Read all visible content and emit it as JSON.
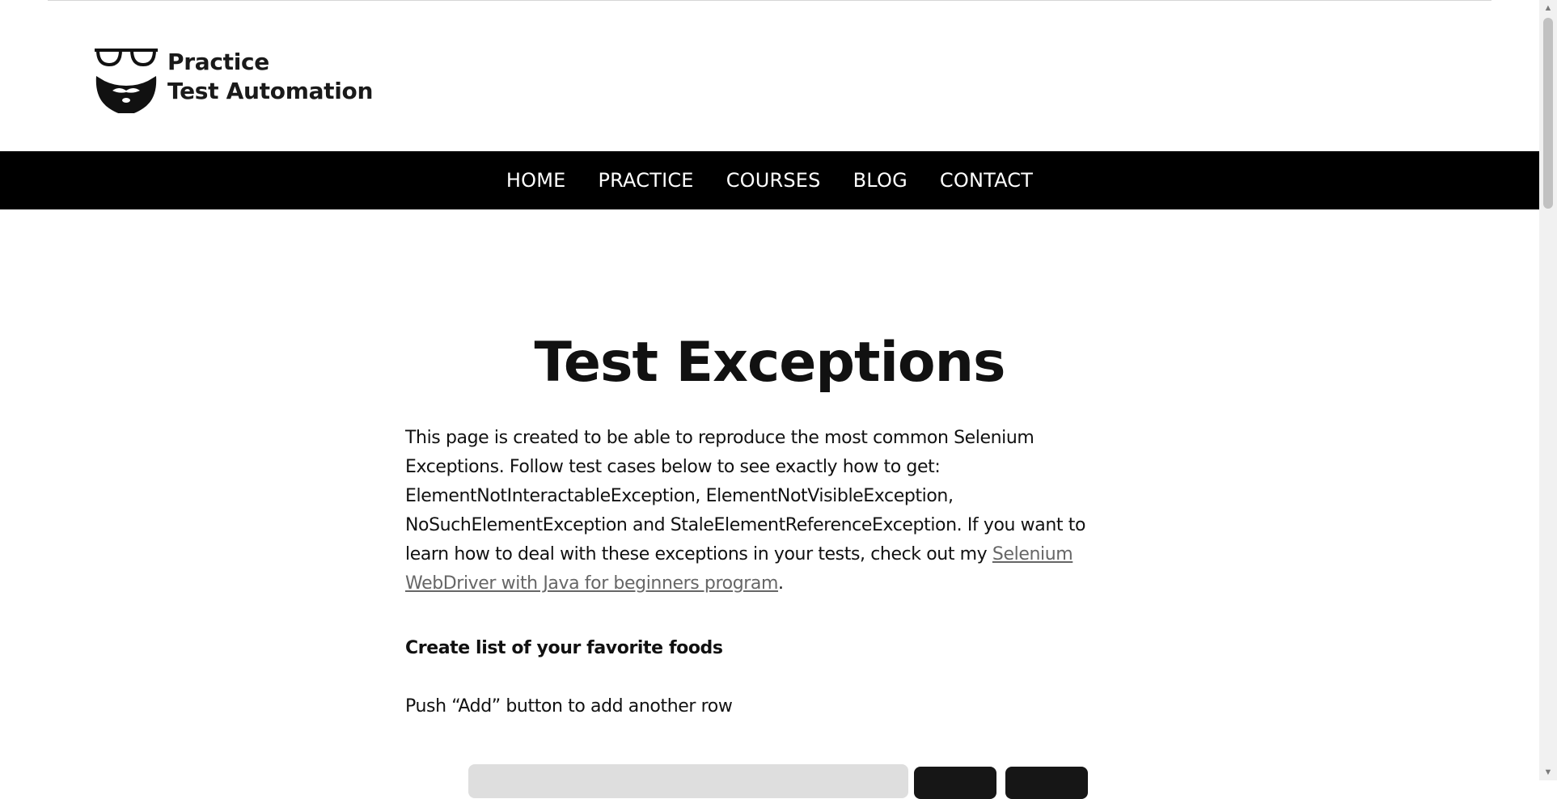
{
  "site": {
    "logo_line1": "Practice",
    "logo_line2": "Test Automation"
  },
  "nav": {
    "items": [
      {
        "label": "HOME"
      },
      {
        "label": "PRACTICE"
      },
      {
        "label": "COURSES"
      },
      {
        "label": "BLOG"
      },
      {
        "label": "CONTACT"
      }
    ]
  },
  "page": {
    "title": "Test Exceptions",
    "intro_text": "This page is created to be able to reproduce the most common Selenium Exceptions. Follow test cases below to see exactly how to get: ElementNotInteractableException, ElementNotVisibleException, NoSuchElementException and StaleElementReferenceException. If you want to learn how to deal with these exceptions in your tests, check out my ",
    "intro_link": "Selenium WebDriver with Java for beginners program",
    "intro_end": ".",
    "section_title": "Create list of your favorite foods",
    "instruction": "Push “Add” button to add another row"
  },
  "colors": {
    "nav_background": "#000000",
    "nav_text": "#ffffff",
    "link": "#666666",
    "input_background": "#dedede",
    "button_background": "#161616"
  },
  "icons": {
    "logo": "bearded-face-with-glasses-icon",
    "scroll_up": "scroll-up-arrow-icon",
    "scroll_down": "scroll-down-arrow-icon"
  }
}
